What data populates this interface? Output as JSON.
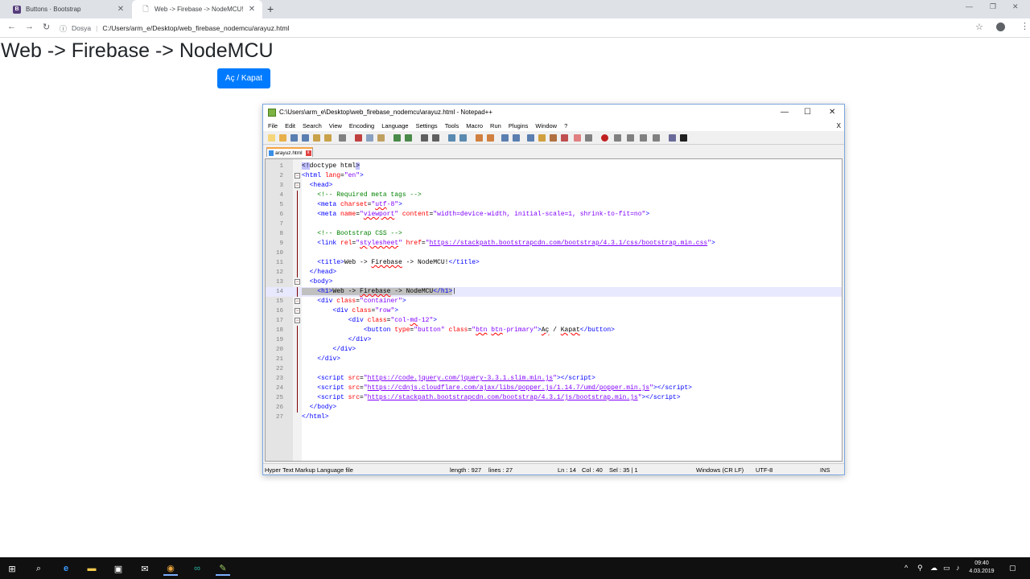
{
  "browser": {
    "tabs": [
      {
        "title": "Buttons · Bootstrap",
        "icon": "B"
      },
      {
        "title": "Web -> Firebase -> NodeMCU!"
      }
    ],
    "new_tab": "+",
    "address_prefix": "Dosya",
    "url": "C:/Users/arm_e/Desktop/web_firebase_nodemcu/arayuz.html"
  },
  "page": {
    "heading": "Web -> Firebase -> NodeMCU",
    "button_label": "Aç / Kapat"
  },
  "notepad": {
    "title": "C:\\Users\\arm_e\\Desktop\\web_firebase_nodemcu\\arayuz.html - Notepad++",
    "menu": [
      "File",
      "Edit",
      "Search",
      "View",
      "Encoding",
      "Language",
      "Settings",
      "Tools",
      "Macro",
      "Run",
      "Plugins",
      "Window",
      "?"
    ],
    "menu_close": "X",
    "doc_tab": "arayuz.html",
    "status": {
      "type": "Hyper Text Markup Language file",
      "length": "length : 927",
      "lines": "lines : 27",
      "ln": "Ln : 14",
      "col": "Col : 40",
      "sel": "Sel : 35 | 1",
      "eol": "Windows (CR LF)",
      "enc": "UTF-8",
      "mode": "INS"
    },
    "line_numbers": [
      "1",
      "2",
      "3",
      "4",
      "5",
      "6",
      "7",
      "8",
      "9",
      "10",
      "11",
      "12",
      "13",
      "14",
      "15",
      "16",
      "17",
      "18",
      "19",
      "20",
      "21",
      "22",
      "23",
      "24",
      "25",
      "26",
      "27"
    ]
  },
  "taskbar": {
    "time": "09:40",
    "date": "4.03.2019"
  },
  "colors": {
    "accent": "#007bff",
    "npp_tag": "#0000ff",
    "npp_attr": "#ff0000",
    "npp_value": "#8000ff",
    "npp_comment": "#008000"
  }
}
